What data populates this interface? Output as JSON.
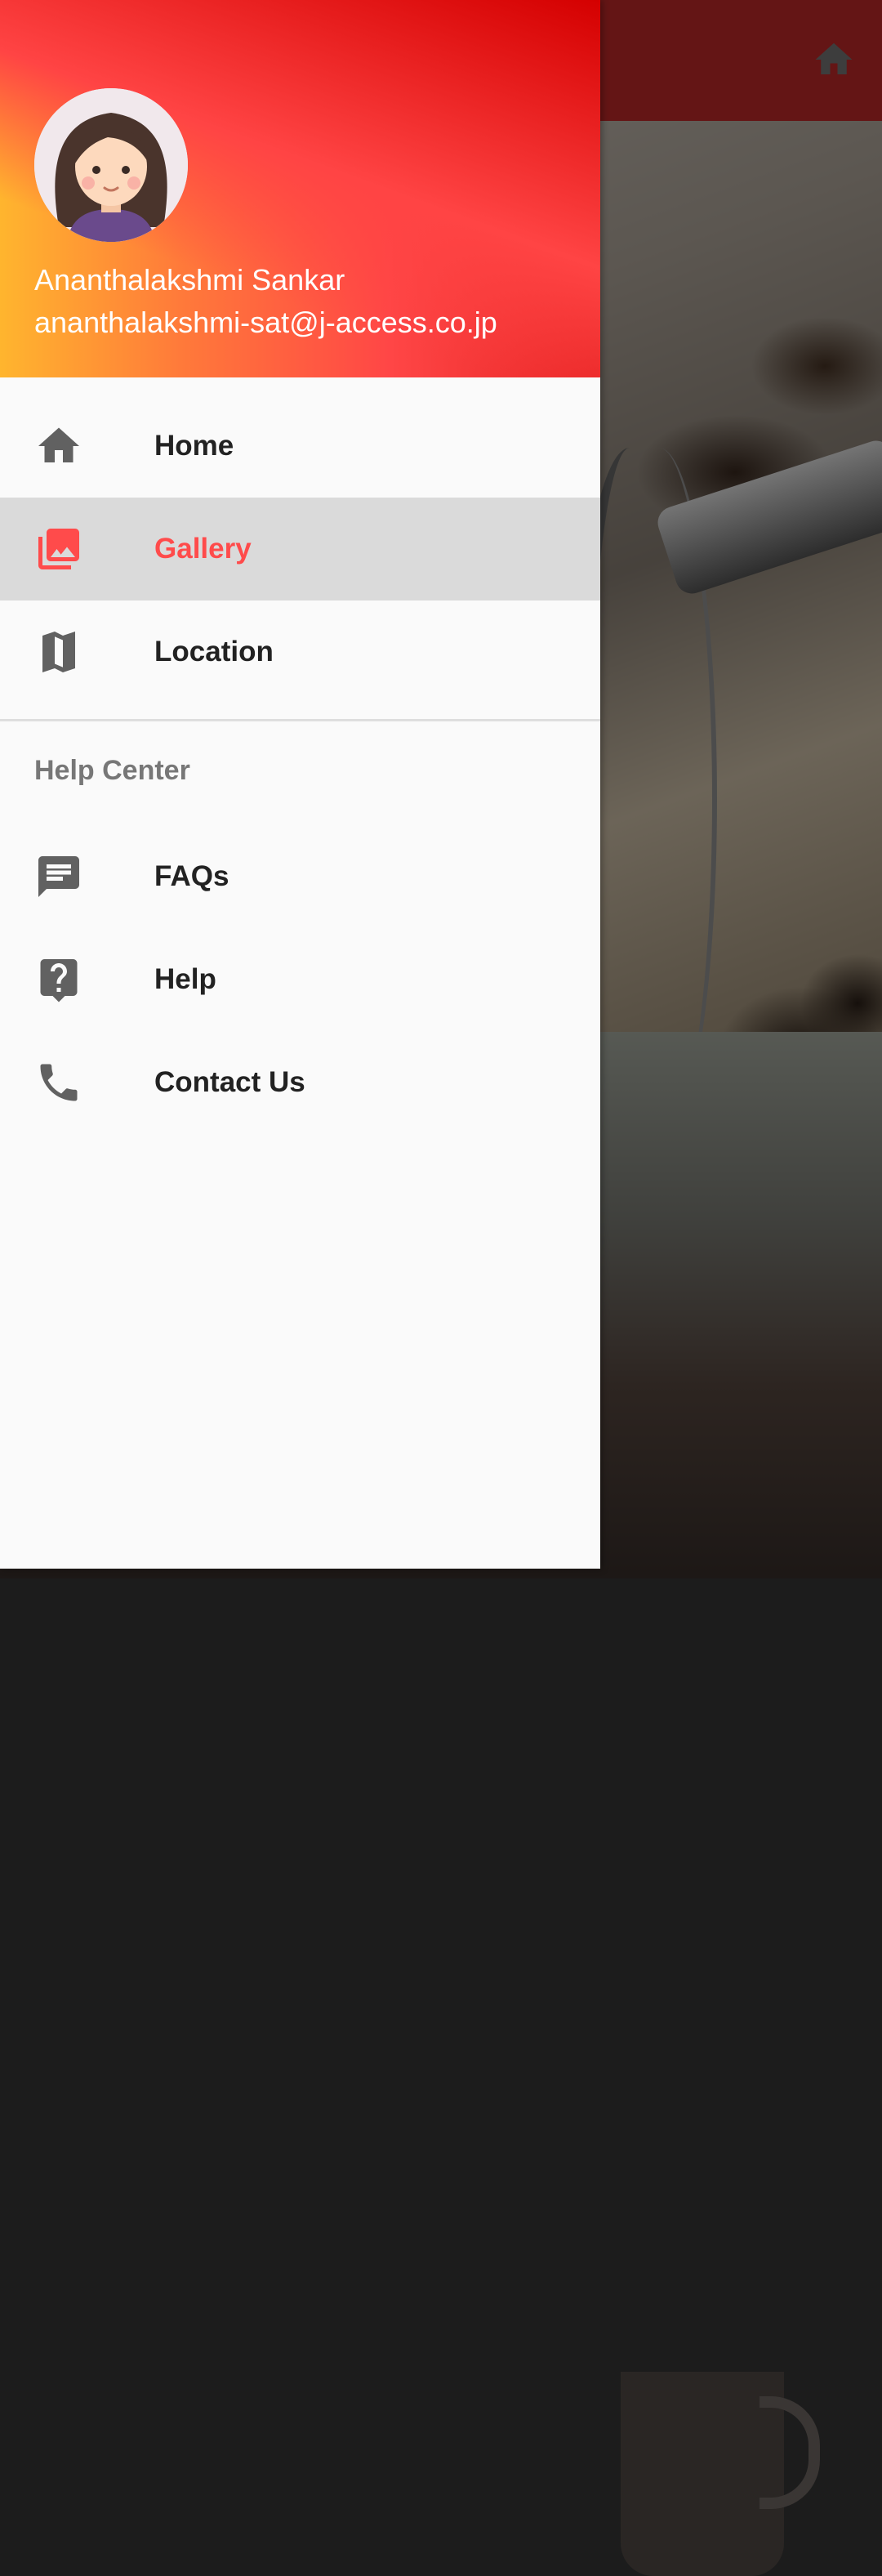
{
  "app": {
    "toolbar_icon": "home-icon",
    "toolbar_color": "#c92a2a"
  },
  "drawer": {
    "header": {
      "gradient_colors": [
        "#ffb52e",
        "#ff4646",
        "#d40000"
      ],
      "name": "Ananthalakshmi Sankar",
      "email": "ananthalakshmi-sat@j-access.co.jp"
    },
    "items": [
      {
        "label": "Home",
        "icon": "home-icon",
        "active": false
      },
      {
        "label": "Gallery",
        "icon": "photo-library-icon",
        "active": true
      },
      {
        "label": "Location",
        "icon": "map-icon",
        "active": false
      }
    ],
    "help_section": {
      "title": "Help Center",
      "items": [
        {
          "label": "FAQs",
          "icon": "message-icon"
        },
        {
          "label": "Help",
          "icon": "help-icon"
        },
        {
          "label": "Contact Us",
          "icon": "phone-icon"
        }
      ]
    },
    "accent_color": "#ff4b4b",
    "icon_color": "#616161"
  }
}
